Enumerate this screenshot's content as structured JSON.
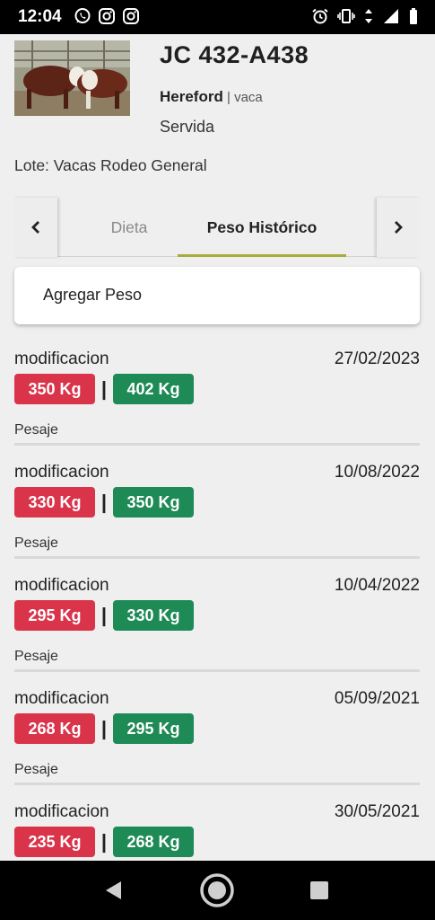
{
  "status_bar": {
    "time": "12:04",
    "left_icons": [
      "whatsapp-icon",
      "instagram-icon",
      "instagram-icon"
    ],
    "right_icons": [
      "alarm-icon",
      "vibrate-icon",
      "data-arrows-icon",
      "signal-icon",
      "battery-icon"
    ]
  },
  "animal": {
    "tag": "JC 432-A438",
    "breed": "Hereford",
    "separator": " | ",
    "type": "vaca",
    "status": "Servida",
    "lote": "Lote: Vacas Rodeo General"
  },
  "tabs": {
    "items": [
      {
        "label": "Dieta",
        "active": false
      },
      {
        "label": "Peso Histórico",
        "active": true
      }
    ],
    "accent": "#a8ac3a"
  },
  "add_button": {
    "label": "Agregar Peso"
  },
  "colors": {
    "old_weight": "#d9344a",
    "new_weight": "#1e8a55"
  },
  "records": [
    {
      "kind": "modificacion",
      "date": "27/02/2023",
      "old": "350 Kg",
      "new": "402 Kg",
      "sep": "|",
      "type": "Pesaje"
    },
    {
      "kind": "modificacion",
      "date": "10/08/2022",
      "old": "330 Kg",
      "new": "350 Kg",
      "sep": "|",
      "type": "Pesaje"
    },
    {
      "kind": "modificacion",
      "date": "10/04/2022",
      "old": "295 Kg",
      "new": "330 Kg",
      "sep": "|",
      "type": "Pesaje"
    },
    {
      "kind": "modificacion",
      "date": "05/09/2021",
      "old": "268 Kg",
      "new": "295 Kg",
      "sep": "|",
      "type": "Pesaje"
    },
    {
      "kind": "modificacion",
      "date": "30/05/2021",
      "old": "235 Kg",
      "new": "268 Kg",
      "sep": "|",
      "type": ""
    }
  ],
  "nav_bar": {
    "buttons": [
      "back-icon",
      "home-icon",
      "recents-icon"
    ]
  }
}
